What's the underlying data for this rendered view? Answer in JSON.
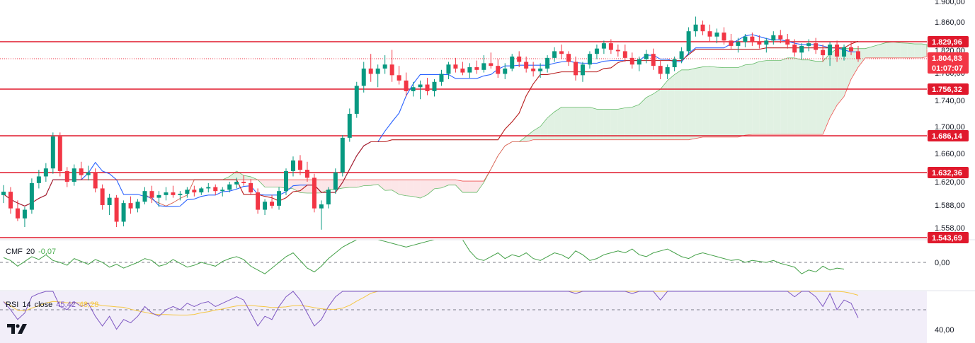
{
  "chart_data": {
    "type": "candlestick",
    "instrument_panel": {
      "y_ticks": [
        "1.900,00",
        "1.860,00",
        "1.820,00",
        "1.780,00",
        "1.740,00",
        "1.700,00",
        "1.660,00",
        "1.620,00",
        "1.588,00",
        "1.558,00"
      ],
      "y_range": [
        1540,
        1900
      ]
    },
    "horizontal_levels": [
      {
        "value": 1829.96,
        "label": "1.829,96"
      },
      {
        "value": 1756.32,
        "label": "1.756,32"
      },
      {
        "value": 1686.14,
        "label": "1.686,14"
      },
      {
        "value": 1632.36,
        "label": "1.632,36"
      },
      {
        "value": 1543.69,
        "label": "1.543,69"
      }
    ],
    "last_price": {
      "value": 1804.83,
      "label": "1.804,83",
      "countdown": "01:07:07"
    },
    "candles": [
      [
        1600,
        1615,
        1588,
        1605
      ],
      [
        1605,
        1612,
        1572,
        1580
      ],
      [
        1580,
        1592,
        1561,
        1565
      ],
      [
        1565,
        1582,
        1552,
        1578
      ],
      [
        1578,
        1625,
        1572,
        1618
      ],
      [
        1618,
        1638,
        1610,
        1628
      ],
      [
        1628,
        1648,
        1620,
        1640
      ],
      [
        1640,
        1694,
        1632,
        1688
      ],
      [
        1688,
        1694,
        1628,
        1636
      ],
      [
        1636,
        1642,
        1612,
        1620
      ],
      [
        1620,
        1646,
        1614,
        1640
      ],
      [
        1640,
        1650,
        1624,
        1630
      ],
      [
        1630,
        1644,
        1622,
        1634
      ],
      [
        1634,
        1640,
        1604,
        1610
      ],
      [
        1610,
        1616,
        1578,
        1585
      ],
      [
        1585,
        1602,
        1570,
        1596
      ],
      [
        1596,
        1600,
        1552,
        1560
      ],
      [
        1560,
        1592,
        1553,
        1588
      ],
      [
        1588,
        1598,
        1572,
        1580
      ],
      [
        1580,
        1594,
        1574,
        1590
      ],
      [
        1590,
        1612,
        1586,
        1606
      ],
      [
        1606,
        1614,
        1588,
        1596
      ],
      [
        1596,
        1606,
        1582,
        1600
      ],
      [
        1600,
        1612,
        1592,
        1604
      ],
      [
        1604,
        1614,
        1596,
        1600
      ],
      [
        1600,
        1606,
        1592,
        1602
      ],
      [
        1602,
        1612,
        1596,
        1608
      ],
      [
        1608,
        1614,
        1598,
        1604
      ],
      [
        1604,
        1612,
        1600,
        1610
      ],
      [
        1610,
        1618,
        1604,
        1612
      ],
      [
        1612,
        1616,
        1600,
        1606
      ],
      [
        1606,
        1612,
        1598,
        1608
      ],
      [
        1608,
        1620,
        1604,
        1616
      ],
      [
        1616,
        1626,
        1610,
        1620
      ],
      [
        1620,
        1630,
        1614,
        1618
      ],
      [
        1618,
        1624,
        1600,
        1604
      ],
      [
        1604,
        1610,
        1572,
        1578
      ],
      [
        1578,
        1594,
        1570,
        1590
      ],
      [
        1590,
        1600,
        1580,
        1584
      ],
      [
        1584,
        1612,
        1578,
        1606
      ],
      [
        1606,
        1640,
        1600,
        1636
      ],
      [
        1636,
        1658,
        1628,
        1652
      ],
      [
        1652,
        1660,
        1630,
        1638
      ],
      [
        1638,
        1650,
        1620,
        1626
      ],
      [
        1626,
        1632,
        1574,
        1580
      ],
      [
        1580,
        1592,
        1548,
        1586
      ],
      [
        1586,
        1612,
        1580,
        1608
      ],
      [
        1608,
        1640,
        1602,
        1634
      ],
      [
        1634,
        1690,
        1628,
        1686
      ],
      [
        1686,
        1730,
        1680,
        1722
      ],
      [
        1722,
        1770,
        1716,
        1764
      ],
      [
        1764,
        1800,
        1754,
        1790
      ],
      [
        1790,
        1812,
        1770,
        1782
      ],
      [
        1782,
        1796,
        1762,
        1790
      ],
      [
        1790,
        1810,
        1782,
        1796
      ],
      [
        1796,
        1818,
        1770,
        1780
      ],
      [
        1780,
        1794,
        1766,
        1772
      ],
      [
        1772,
        1784,
        1748,
        1756
      ],
      [
        1756,
        1770,
        1748,
        1762
      ],
      [
        1762,
        1772,
        1744,
        1766
      ],
      [
        1766,
        1776,
        1750,
        1756
      ],
      [
        1756,
        1774,
        1748,
        1770
      ],
      [
        1770,
        1788,
        1764,
        1782
      ],
      [
        1782,
        1800,
        1774,
        1796
      ],
      [
        1796,
        1806,
        1784,
        1790
      ],
      [
        1790,
        1800,
        1780,
        1784
      ],
      [
        1784,
        1798,
        1776,
        1792
      ],
      [
        1792,
        1802,
        1782,
        1788
      ],
      [
        1788,
        1810,
        1784,
        1798
      ],
      [
        1798,
        1814,
        1790,
        1794
      ],
      [
        1794,
        1804,
        1776,
        1782
      ],
      [
        1782,
        1798,
        1774,
        1790
      ],
      [
        1790,
        1812,
        1786,
        1808
      ],
      [
        1808,
        1816,
        1792,
        1800
      ],
      [
        1800,
        1808,
        1784,
        1790
      ],
      [
        1790,
        1800,
        1778,
        1786
      ],
      [
        1786,
        1798,
        1776,
        1790
      ],
      [
        1790,
        1810,
        1784,
        1806
      ],
      [
        1806,
        1822,
        1800,
        1816
      ],
      [
        1816,
        1826,
        1804,
        1812
      ],
      [
        1812,
        1816,
        1794,
        1800
      ],
      [
        1800,
        1808,
        1772,
        1780
      ],
      [
        1780,
        1800,
        1770,
        1796
      ],
      [
        1796,
        1816,
        1790,
        1812
      ],
      [
        1812,
        1826,
        1804,
        1820
      ],
      [
        1820,
        1832,
        1812,
        1828
      ],
      [
        1828,
        1834,
        1812,
        1818
      ],
      [
        1818,
        1826,
        1808,
        1816
      ],
      [
        1816,
        1826,
        1800,
        1806
      ],
      [
        1806,
        1814,
        1790,
        1796
      ],
      [
        1796,
        1808,
        1786,
        1804
      ],
      [
        1804,
        1818,
        1798,
        1812
      ],
      [
        1812,
        1820,
        1788,
        1794
      ],
      [
        1794,
        1802,
        1774,
        1782
      ],
      [
        1782,
        1796,
        1774,
        1792
      ],
      [
        1792,
        1808,
        1786,
        1804
      ],
      [
        1804,
        1822,
        1798,
        1816
      ],
      [
        1816,
        1852,
        1810,
        1846
      ],
      [
        1846,
        1868,
        1838,
        1856
      ],
      [
        1856,
        1862,
        1840,
        1846
      ],
      [
        1846,
        1856,
        1830,
        1838
      ],
      [
        1838,
        1850,
        1828,
        1844
      ],
      [
        1844,
        1852,
        1826,
        1832
      ],
      [
        1832,
        1842,
        1818,
        1824
      ],
      [
        1824,
        1836,
        1814,
        1830
      ],
      [
        1830,
        1842,
        1822,
        1838
      ],
      [
        1838,
        1844,
        1824,
        1830
      ],
      [
        1830,
        1840,
        1820,
        1826
      ],
      [
        1826,
        1836,
        1814,
        1832
      ],
      [
        1832,
        1846,
        1826,
        1840
      ],
      [
        1840,
        1848,
        1828,
        1834
      ],
      [
        1834,
        1842,
        1820,
        1826
      ],
      [
        1826,
        1834,
        1808,
        1814
      ],
      [
        1814,
        1828,
        1804,
        1824
      ],
      [
        1824,
        1834,
        1816,
        1828
      ],
      [
        1828,
        1836,
        1812,
        1818
      ],
      [
        1818,
        1826,
        1800,
        1810
      ],
      [
        1810,
        1830,
        1794,
        1826
      ],
      [
        1826,
        1832,
        1800,
        1808
      ],
      [
        1808,
        1826,
        1802,
        1822
      ],
      [
        1822,
        1830,
        1810,
        1816
      ],
      [
        1816,
        1824,
        1800,
        1804
      ]
    ],
    "tenkan_color": "#2962ff",
    "kijun_color": "#b71c1c",
    "cloud_bull_color": "#d7ecd9",
    "cloud_bear_color": "#fbdde0",
    "candle_up_color": "#089981",
    "candle_down_color": "#f23645",
    "level_color": "#e0192c",
    "cmf": {
      "label": "CMF",
      "period": "20",
      "value": "-0,07",
      "zero_label": "0,00",
      "values": [
        0.05,
        0.02,
        -0.04,
        0.01,
        0.06,
        0.03,
        0.08,
        0.02,
        0.0,
        -0.03,
        0.04,
        0.01,
        -0.02,
        0.03,
        0.0,
        -0.05,
        -0.02,
        -0.06,
        -0.03,
        0.0,
        0.04,
        0.02,
        -0.04,
        -0.02,
        0.03,
        -0.01,
        -0.05,
        -0.03,
        0.0,
        -0.02,
        -0.04,
        0.01,
        0.04,
        0.06,
        0.03,
        -0.04,
        -0.08,
        -0.12,
        -0.06,
        0.0,
        0.06,
        0.1,
        0.02,
        -0.06,
        -0.1,
        -0.04,
        0.04,
        0.1,
        0.16,
        0.2,
        0.24,
        0.26,
        0.28,
        0.24,
        0.22,
        0.2,
        0.18,
        0.16,
        0.18,
        0.2,
        0.22,
        0.24,
        0.26,
        0.27,
        0.28,
        0.26,
        0.12,
        0.04,
        0.02,
        0.06,
        0.1,
        0.04,
        0.08,
        0.06,
        0.1,
        0.04,
        0.02,
        0.06,
        0.1,
        0.08,
        0.04,
        0.12,
        0.08,
        0.02,
        0.04,
        0.08,
        0.1,
        0.12,
        0.1,
        0.14,
        0.08,
        0.06,
        0.1,
        0.12,
        0.14,
        0.1,
        0.06,
        0.04,
        0.08,
        0.1,
        0.08,
        0.06,
        0.04,
        0.02,
        0.03,
        0.0,
        0.02,
        0.01,
        0.0,
        0.02,
        -0.01,
        -0.03,
        -0.05,
        -0.12,
        -0.08,
        -0.1,
        -0.04,
        -0.08,
        -0.06,
        -0.07
      ]
    },
    "rsi": {
      "label": "RSI",
      "period": "14",
      "source": "close",
      "value": "45,42",
      "ma_value": "48,28",
      "tick": "40,00",
      "values": [
        55,
        50,
        44,
        48,
        58,
        60,
        64,
        62,
        52,
        50,
        55,
        52,
        54,
        46,
        40,
        46,
        38,
        44,
        42,
        46,
        52,
        48,
        46,
        50,
        52,
        50,
        54,
        52,
        54,
        55,
        52,
        54,
        56,
        58,
        56,
        48,
        40,
        46,
        44,
        52,
        58,
        62,
        56,
        48,
        40,
        44,
        52,
        58,
        66,
        72,
        76,
        78,
        80,
        76,
        74,
        72,
        70,
        66,
        68,
        70,
        68,
        70,
        74,
        76,
        74,
        72,
        74,
        72,
        76,
        74,
        68,
        72,
        76,
        74,
        68,
        70,
        68,
        72,
        76,
        74,
        66,
        60,
        68,
        72,
        74,
        76,
        72,
        70,
        66,
        60,
        64,
        70,
        64,
        56,
        62,
        68,
        72,
        80,
        84,
        78,
        70,
        72,
        68,
        62,
        66,
        70,
        66,
        62,
        66,
        70,
        66,
        64,
        58,
        62,
        64,
        58,
        52,
        60,
        50,
        56,
        54,
        45
      ]
    },
    "tradingview_logo": "TV"
  }
}
